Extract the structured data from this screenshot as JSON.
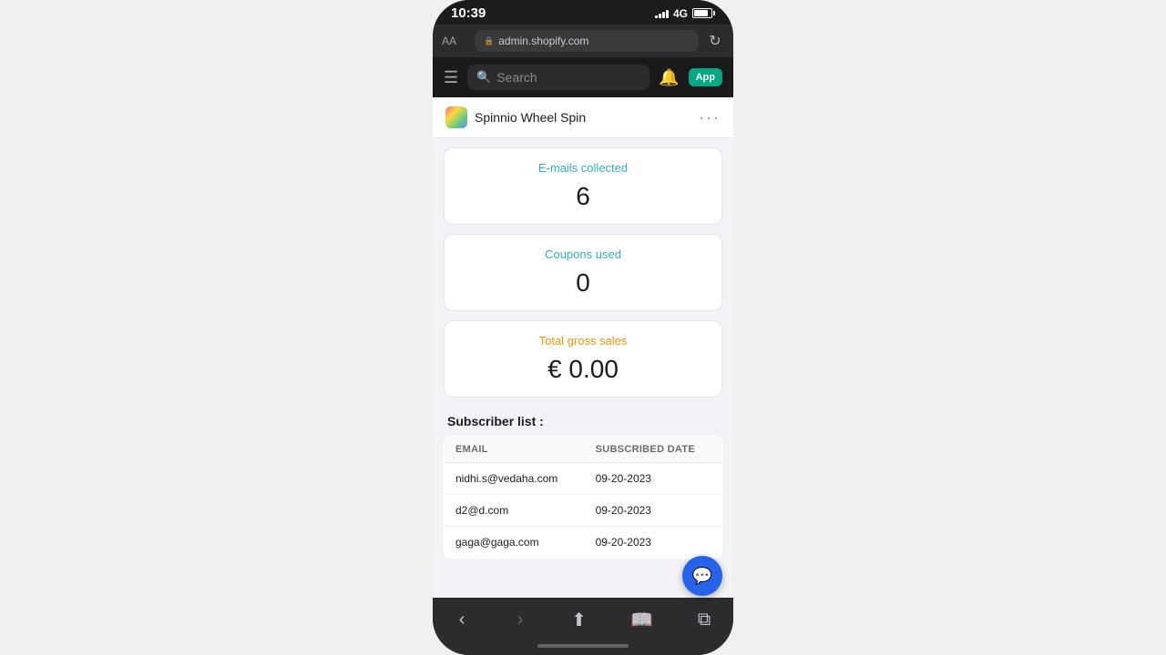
{
  "status_bar": {
    "time": "10:39",
    "network": "4G"
  },
  "browser_bar": {
    "aa_label": "AA",
    "url": "admin.shopify.com"
  },
  "shopify_toolbar": {
    "search_placeholder": "Search",
    "app_badge": "App"
  },
  "app_header": {
    "app_name": "Spinnio Wheel Spin",
    "more_label": "···"
  },
  "stats": {
    "emails": {
      "label": "E-mails collected",
      "value": "6"
    },
    "coupons": {
      "label": "Coupons used",
      "value": "0"
    },
    "sales": {
      "label": "Total gross sales",
      "value": "€ 0.00"
    }
  },
  "subscriber_list": {
    "title": "Subscriber list :",
    "columns": {
      "email": "EMAIL",
      "date": "SUBSCRIBED DATE"
    },
    "rows": [
      {
        "email": "nidhi.s@vedaha.com",
        "date": "09-20-2023"
      },
      {
        "email": "d2@d.com",
        "date": "09-20-2023"
      },
      {
        "email": "gaga@gaga.com",
        "date": "09-20-2023"
      }
    ]
  }
}
